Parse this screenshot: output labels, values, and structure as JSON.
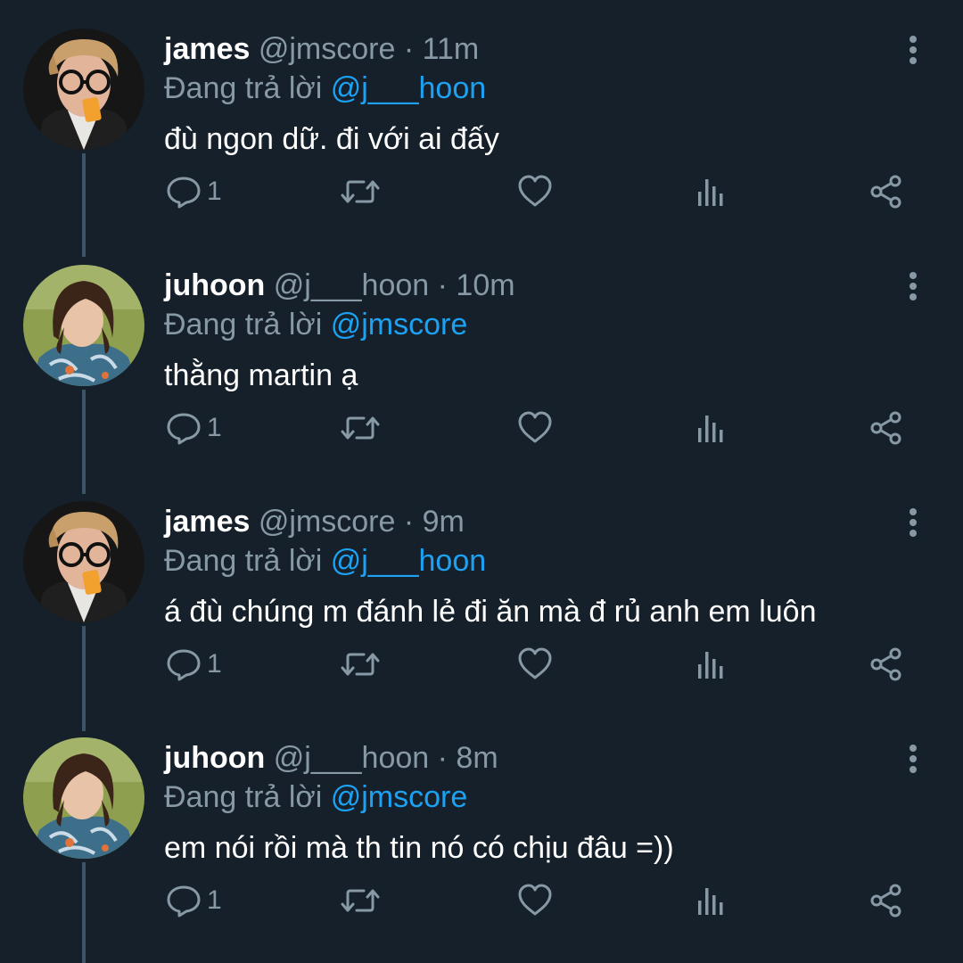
{
  "colors": {
    "background": "#15202b",
    "secondary_text": "#8899a6",
    "link": "#1da1f2",
    "thread_line": "#3d5466"
  },
  "reply_prefix": "Đang trả lời",
  "tweets": [
    {
      "name": "james",
      "handle": "@jmscore",
      "separator": "·",
      "time": "11m",
      "replying_to": "@j___hoon",
      "text": "đù ngon dữ. đi với ai đấy",
      "reply_count": "1",
      "avatar": "avatar-james"
    },
    {
      "name": "juhoon",
      "handle": "@j___hoon",
      "separator": "·",
      "time": "10m",
      "replying_to": "@jmscore",
      "text": "thằng martin ạ",
      "reply_count": "1",
      "avatar": "avatar-juhoon"
    },
    {
      "name": "james",
      "handle": "@jmscore",
      "separator": "·",
      "time": "9m",
      "replying_to": "@j___hoon",
      "text": "á đù chúng m đánh lẻ đi ăn mà đ rủ anh em luôn",
      "reply_count": "1",
      "avatar": "avatar-james"
    },
    {
      "name": "juhoon",
      "handle": "@j___hoon",
      "separator": "·",
      "time": "8m",
      "replying_to": "@jmscore",
      "text": "em nói rồi mà th tin nó có chịu đâu =))",
      "reply_count": "1",
      "avatar": "avatar-juhoon"
    }
  ]
}
